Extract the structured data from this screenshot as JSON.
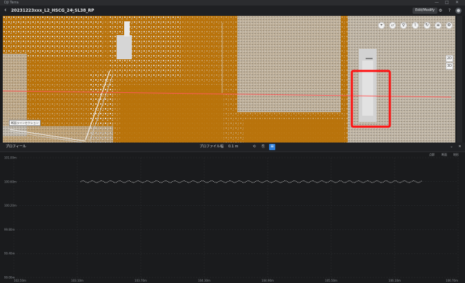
{
  "window": {
    "app_title": "DJI Terra",
    "minimize": "—",
    "maximize": "□",
    "close": "✕"
  },
  "toolbar": {
    "back": "‹",
    "project_name": "20231223xxx_L2_HSCG_24_SL38_RP",
    "edit_icon": "✎",
    "modify_button": "Edit/Modify",
    "icons": [
      "settings-icon",
      "help-icon",
      "user-icon"
    ]
  },
  "viewport": {
    "tools": [
      "measure-point-icon",
      "measure-area-icon",
      "pin-icon",
      "profile-icon",
      "rotate-icon",
      "layers-icon",
      "settings-icon"
    ],
    "zoom": {
      "in": "2D",
      "out": "3D"
    },
    "section_label": "断面ラインセクション"
  },
  "profile_panel": {
    "title": "プロフィール",
    "profile_width_label": "プロファイル幅",
    "profile_width_value": "0.1",
    "profile_width_unit": "m",
    "legend": [
      "点群",
      "断面",
      "地形"
    ],
    "window_controls": {
      "collapse": "⌄",
      "close": "✕"
    }
  },
  "chart_data": {
    "type": "scatter",
    "y_ticks": [
      "101.00m",
      "100.60m",
      "100.20m",
      "99.80m",
      "99.40m",
      "99.00m"
    ],
    "x_ticks": [
      "102.50m",
      "103.10m",
      "103.70m",
      "104.30m",
      "104.90m",
      "105.50m",
      "106.10m",
      "106.70m"
    ],
    "ylim": [
      99.0,
      101.0
    ],
    "xlim": [
      102.5,
      106.7
    ],
    "grid": true,
    "series": [
      {
        "x_start": 103.13,
        "x_end": 106.35,
        "y_center": 100.6,
        "amplitude": 0.015,
        "color": "#e9e9e9"
      }
    ]
  }
}
